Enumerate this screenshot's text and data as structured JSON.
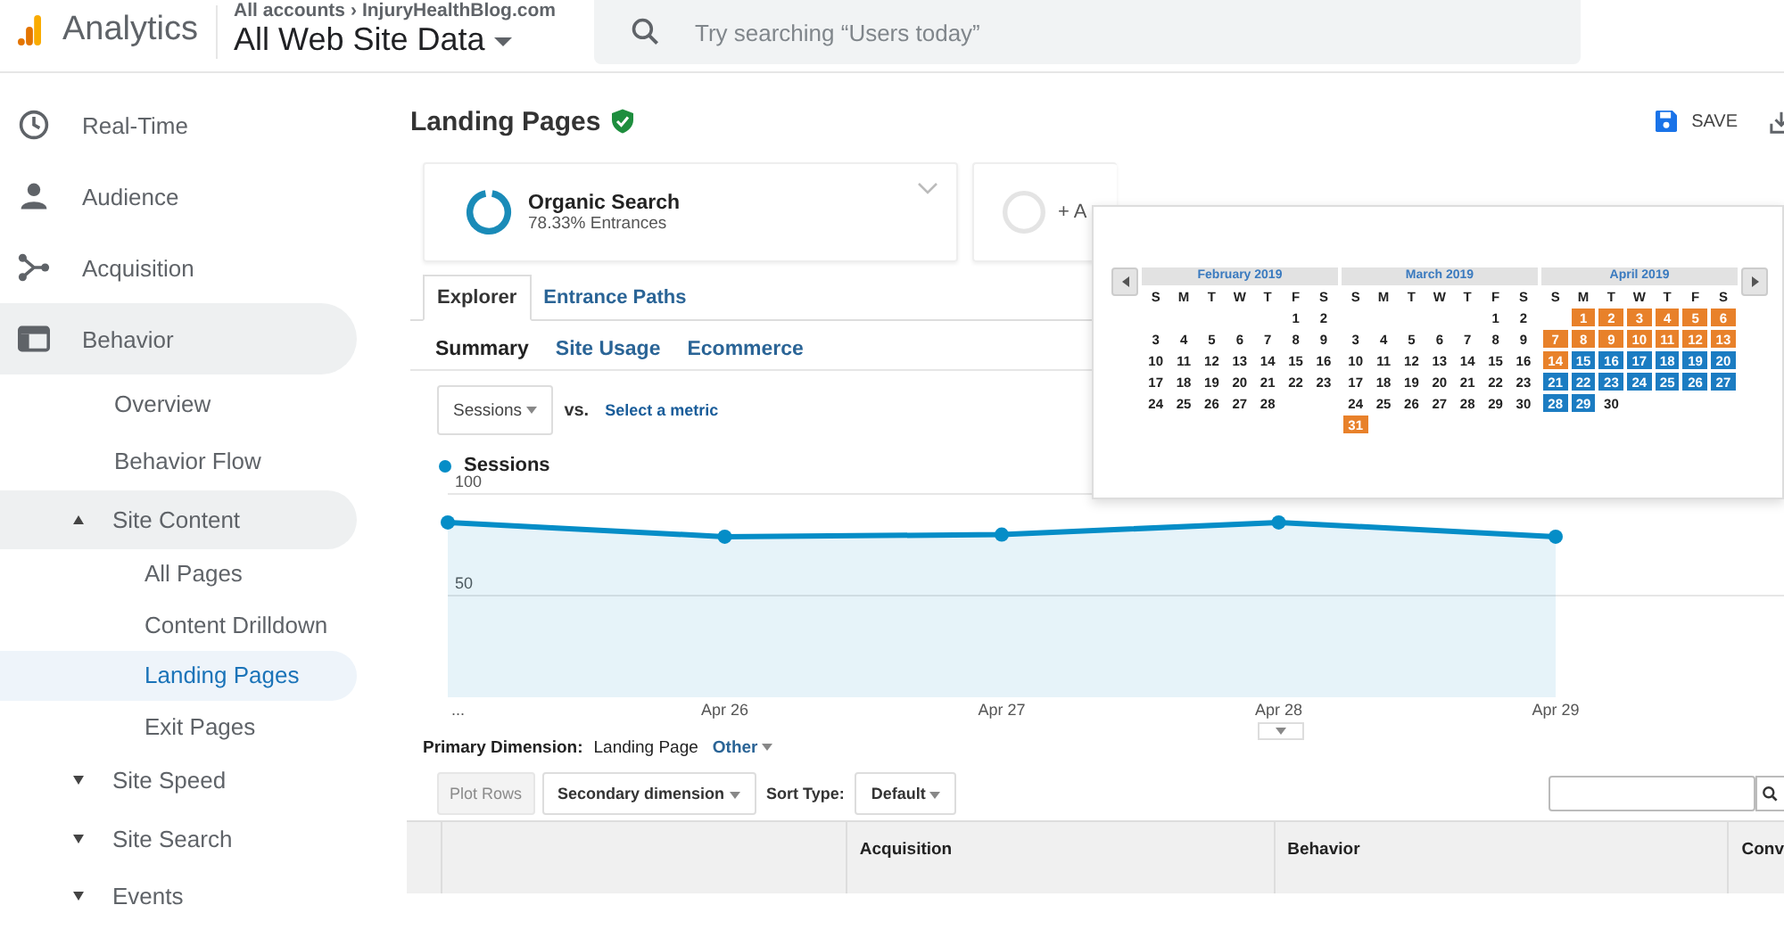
{
  "app": {
    "name": "Analytics"
  },
  "account": {
    "breadcrumb": [
      "All accounts",
      "InjuryHealthBlog.com"
    ],
    "separator": "›",
    "view": "All Web Site Data"
  },
  "search": {
    "placeholder": "Try searching “Users today”"
  },
  "sidebar": {
    "items": [
      {
        "label": "Real-Time",
        "selected": false
      },
      {
        "label": "Audience",
        "selected": false
      },
      {
        "label": "Acquisition",
        "selected": false
      },
      {
        "label": "Behavior",
        "selected": true,
        "children": [
          {
            "label": "Overview",
            "selected": false
          },
          {
            "label": "Behavior Flow",
            "selected": false
          },
          {
            "label": "Site Content",
            "selected": true,
            "expanded": true,
            "children": [
              {
                "label": "All Pages",
                "selected": false
              },
              {
                "label": "Content Drilldown",
                "selected": false
              },
              {
                "label": "Landing Pages",
                "selected": true
              },
              {
                "label": "Exit Pages",
                "selected": false
              }
            ]
          },
          {
            "label": "Site Speed",
            "selected": false,
            "expanded": false
          },
          {
            "label": "Site Search",
            "selected": false,
            "expanded": false
          },
          {
            "label": "Events",
            "selected": false,
            "expanded": false
          }
        ]
      }
    ]
  },
  "page": {
    "title": "Landing Pages",
    "verified": true,
    "actions": [
      {
        "kind": "save",
        "label": "SAVE"
      },
      {
        "kind": "download"
      }
    ]
  },
  "segments": [
    {
      "kind": "segment",
      "name": "Organic Search",
      "detail": "78.33% Entrances"
    },
    {
      "kind": "add",
      "name": "+ A"
    }
  ],
  "tabs": [
    {
      "label": "Explorer",
      "selected": true
    },
    {
      "label": "Entrance Paths",
      "selected": false
    }
  ],
  "subtabs": [
    {
      "label": "Summary",
      "selected": true
    },
    {
      "label": "Site Usage",
      "selected": false
    },
    {
      "label": "Ecommerce",
      "selected": false
    }
  ],
  "metric": {
    "value": "Sessions",
    "vs": "vs.",
    "compare_link": "Select a metric"
  },
  "chart_data": {
    "type": "area",
    "marker": true,
    "categories": [
      "...",
      "Apr 26",
      "Apr 27",
      "Apr 28",
      "Apr 29"
    ],
    "ylim": [
      0,
      100
    ],
    "yticks": [
      50,
      100
    ],
    "series": [
      {
        "name": "Sessions",
        "color": "#058dc7",
        "values": [
          86,
          79,
          80,
          86,
          79
        ]
      }
    ]
  },
  "calendar": {
    "months": [
      {
        "title": "February 2019",
        "weekdays": [
          "S",
          "M",
          "T",
          "W",
          "T",
          "F",
          "S"
        ],
        "weeks": [
          [
            {
              "day": "1"
            },
            {
              "day": "2"
            }
          ],
          [
            {
              "day": "3"
            },
            {
              "day": "4"
            },
            {
              "day": "5"
            },
            {
              "day": "6"
            },
            {
              "day": "7"
            },
            {
              "day": "8"
            },
            {
              "day": "9"
            }
          ],
          [
            {
              "day": "10"
            },
            {
              "day": "11"
            },
            {
              "day": "12"
            },
            {
              "day": "13"
            },
            {
              "day": "14"
            },
            {
              "day": "15"
            },
            {
              "day": "16"
            }
          ],
          [
            {
              "day": "17"
            },
            {
              "day": "18"
            },
            {
              "day": "19"
            },
            {
              "day": "20"
            },
            {
              "day": "21"
            },
            {
              "day": "22"
            },
            {
              "day": "23"
            }
          ],
          [
            {
              "day": "24"
            },
            {
              "day": "25"
            },
            {
              "day": "26"
            },
            {
              "day": "27"
            },
            {
              "day": "28"
            }
          ]
        ]
      },
      {
        "title": "March 2019",
        "weekdays": [
          "S",
          "M",
          "T",
          "W",
          "T",
          "F",
          "S"
        ],
        "weeks": [
          [
            {
              "day": "1"
            },
            {
              "day": "2"
            }
          ],
          [
            {
              "day": "3"
            },
            {
              "day": "4"
            },
            {
              "day": "5"
            },
            {
              "day": "6"
            },
            {
              "day": "7"
            },
            {
              "day": "8"
            },
            {
              "day": "9"
            }
          ],
          [
            {
              "day": "10"
            },
            {
              "day": "11"
            },
            {
              "day": "12"
            },
            {
              "day": "13"
            },
            {
              "day": "14"
            },
            {
              "day": "15"
            },
            {
              "day": "16"
            }
          ],
          [
            {
              "day": "17"
            },
            {
              "day": "18"
            },
            {
              "day": "19"
            },
            {
              "day": "20"
            },
            {
              "day": "21"
            },
            {
              "day": "22"
            },
            {
              "day": "23"
            }
          ],
          [
            {
              "day": "24"
            },
            {
              "day": "25"
            },
            {
              "day": "26"
            },
            {
              "day": "27"
            },
            {
              "day": "28"
            },
            {
              "day": "29"
            },
            {
              "day": "30"
            }
          ],
          [
            {
              "day": "31",
              "color": "#e8812a"
            }
          ]
        ]
      },
      {
        "title": "April 2019",
        "weekdays": [
          "S",
          "M",
          "T",
          "W",
          "T",
          "F",
          "S"
        ],
        "weeks": [
          [
            {
              "day": "1",
              "color": "#e8812a"
            },
            {
              "day": "2",
              "color": "#e8812a"
            },
            {
              "day": "3",
              "color": "#e8812a"
            },
            {
              "day": "4",
              "color": "#e8812a"
            },
            {
              "day": "5",
              "color": "#e8812a"
            },
            {
              "day": "6",
              "color": "#e8812a"
            }
          ],
          [
            {
              "day": "7",
              "color": "#e8812a"
            },
            {
              "day": "8",
              "color": "#e8812a"
            },
            {
              "day": "9",
              "color": "#e8812a"
            },
            {
              "day": "10",
              "color": "#e8812a"
            },
            {
              "day": "11",
              "color": "#e8812a"
            },
            {
              "day": "12",
              "color": "#e8812a"
            },
            {
              "day": "13",
              "color": "#e8812a"
            }
          ],
          [
            {
              "day": "14",
              "color": "#e8812a"
            },
            {
              "day": "15",
              "color": "#1b7cc2"
            },
            {
              "day": "16",
              "color": "#1b7cc2"
            },
            {
              "day": "17",
              "color": "#1b7cc2"
            },
            {
              "day": "18",
              "color": "#1b7cc2"
            },
            {
              "day": "19",
              "color": "#1b7cc2"
            },
            {
              "day": "20",
              "color": "#1b7cc2"
            }
          ],
          [
            {
              "day": "21",
              "color": "#1b7cc2"
            },
            {
              "day": "22",
              "color": "#1b7cc2"
            },
            {
              "day": "23",
              "color": "#1b7cc2"
            },
            {
              "day": "24",
              "color": "#1b7cc2"
            },
            {
              "day": "25",
              "color": "#1b7cc2"
            },
            {
              "day": "26",
              "color": "#1b7cc2"
            },
            {
              "day": "27",
              "color": "#1b7cc2"
            }
          ],
          [
            {
              "day": "28",
              "color": "#1b7cc2"
            },
            {
              "day": "29",
              "color": "#1b7cc2"
            },
            {
              "day": "30"
            }
          ]
        ]
      }
    ]
  },
  "primary_dimension": {
    "label": "Primary Dimension:",
    "value": "Landing Page",
    "other": "Other"
  },
  "toolbar": {
    "plot_rows": {
      "label": "Plot Rows",
      "disabled": true
    },
    "secondary": "Secondary dimension",
    "sort_label": "Sort Type:",
    "sort": "Default"
  },
  "table": {
    "column_groups": [
      "Acquisition",
      "Behavior",
      "Conv"
    ]
  }
}
